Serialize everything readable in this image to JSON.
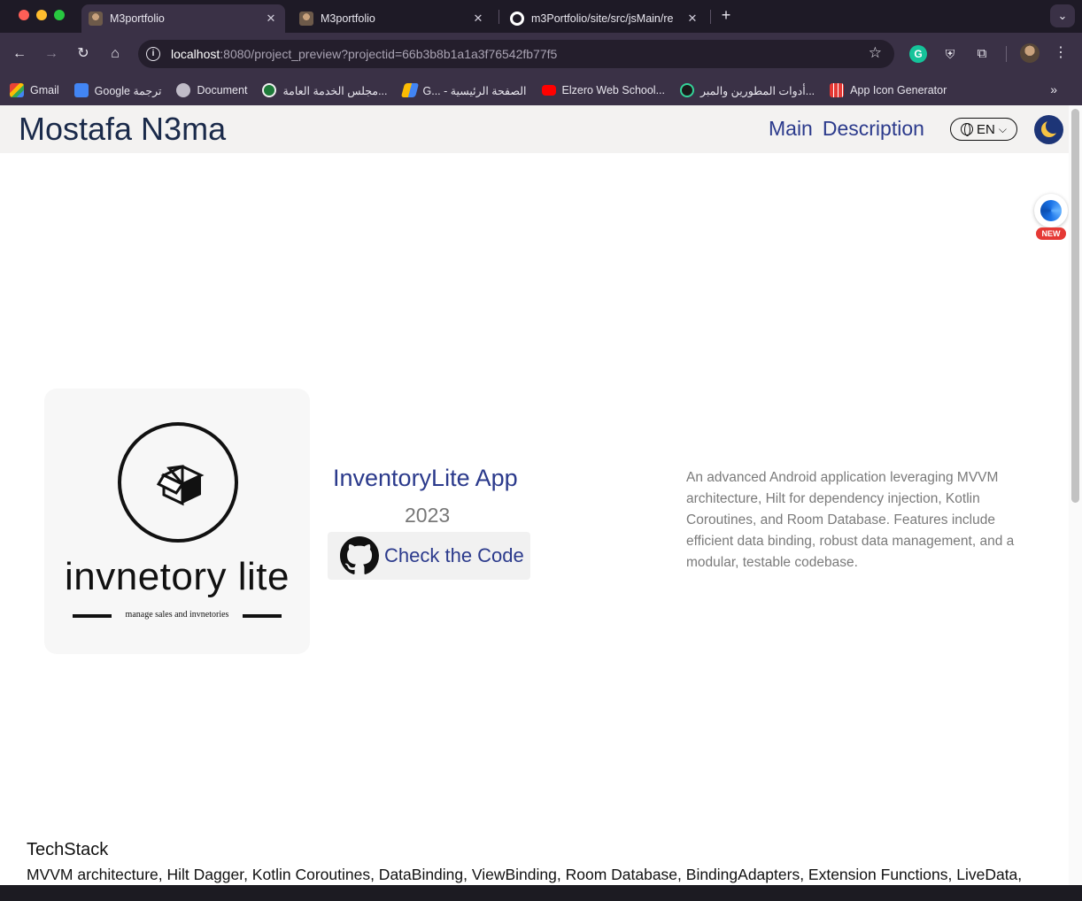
{
  "browser": {
    "tabs": [
      {
        "title": "M3portfolio",
        "active": true
      },
      {
        "title": "M3portfolio",
        "active": false
      },
      {
        "title": "m3Portfolio/site/src/jsMain/re",
        "active": false
      }
    ],
    "url_host": "localhost",
    "url_rest": ":8080/project_preview?projectid=66b3b8b1a1a3f76542fb77f5",
    "bookmarks": [
      {
        "label": "Gmail",
        "icon": "gmail-icon"
      },
      {
        "label": "Google ترجمة",
        "icon": "google-translate-icon"
      },
      {
        "label": "Document",
        "icon": "document-icon"
      },
      {
        "label": "مجلس الخدمة العامة...",
        "icon": "gov-icon"
      },
      {
        "label": "G... - الصفحة الرئيسية",
        "icon": "google-ads-icon"
      },
      {
        "label": "Elzero Web School...",
        "icon": "youtube-icon"
      },
      {
        "label": "أدوات المطورين والمبر...",
        "icon": "dev-tools-icon"
      },
      {
        "label": "App Icon Generator",
        "icon": "app-icon-generator-icon"
      }
    ],
    "extension_badge": "NEW"
  },
  "site": {
    "title": "Mostafa N3ma",
    "nav": [
      "Main",
      "Description"
    ],
    "language": "EN"
  },
  "project": {
    "logo_name": "invnetory lite",
    "logo_tagline": "manage sales and invnetories",
    "title": "InventoryLite App",
    "year": "2023",
    "code_button": "Check the Code",
    "description": "An advanced Android application leveraging MVVM architecture, Hilt for dependency injection, Kotlin Coroutines, and Room Database. Features include efficient data binding, robust data management, and a modular, testable codebase."
  },
  "techstack": {
    "heading": "TechStack",
    "items": "MVVM architecture, Hilt Dagger, Kotlin Coroutines, DataBinding, ViewBinding, Room Database, BindingAdapters, Extension Functions, LiveData,"
  },
  "colors": {
    "accent": "#2b3a8c",
    "title": "#1a2a4a",
    "muted": "#7a7a7a"
  }
}
